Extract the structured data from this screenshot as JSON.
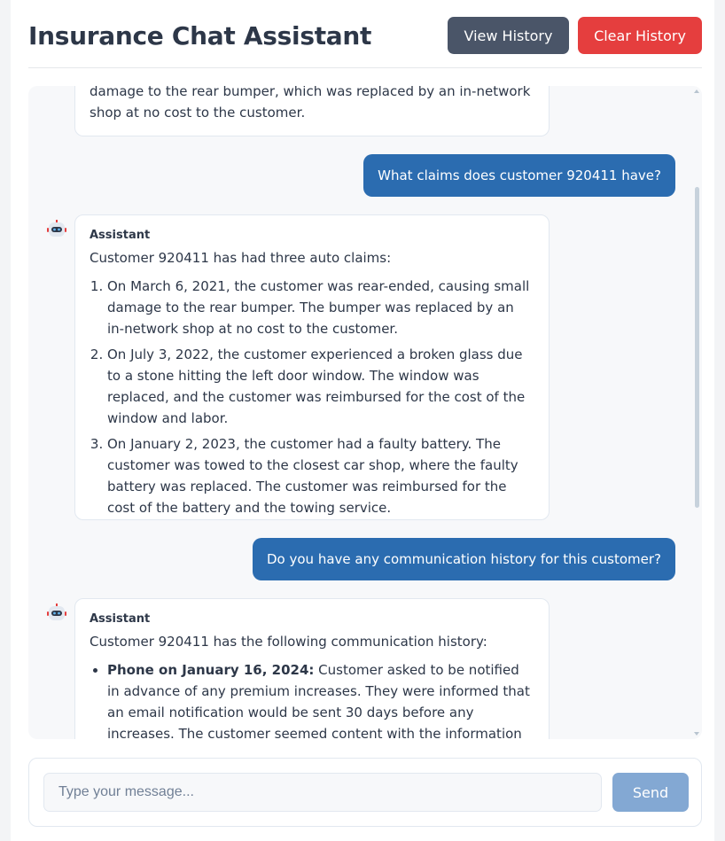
{
  "header": {
    "title": "Insurance Chat Assistant",
    "view_history_label": "View History",
    "clear_history_label": "Clear History"
  },
  "colors": {
    "primary": "#2b6cb0",
    "danger": "#e53e3e",
    "secondary": "#4a5568",
    "send_disabled": "#83a8d3"
  },
  "chat": {
    "partial_top": "damage to the rear bumper, which was replaced by an in-network shop at no cost to the customer.",
    "messages": [
      {
        "role": "user",
        "text": "What claims does customer 920411 have?"
      },
      {
        "role": "assistant",
        "name": "Assistant",
        "intro": "Customer 920411 has had three auto claims:",
        "items": [
          "On March 6, 2021, the customer was rear-ended, causing small damage to the rear bumper. The bumper was replaced by an in-network shop at no cost to the customer.",
          "On July 3, 2022, the customer experienced a broken glass due to a stone hitting the left door window. The window was replaced, and the customer was reimbursed for the cost of the window and labor.",
          "On January 2, 2023, the customer had a faulty battery. The customer was towed to the closest car shop, where the faulty battery was replaced. The customer was reimbursed for the cost of the battery and the towing service."
        ]
      },
      {
        "role": "user",
        "text": "Do you have any communication history for this customer?"
      },
      {
        "role": "assistant",
        "name": "Assistant",
        "intro": "Customer 920411 has the following communication history:",
        "items": [
          {
            "label": "Phone on January 16, 2024:",
            "text": " Customer asked to be notified in advance of any premium increases. They were informed that an email notification would be sent 30 days before any increases. The customer seemed content with the information but unhappy that no"
          }
        ]
      }
    ],
    "avatar_icon": "robot-icon"
  },
  "composer": {
    "placeholder": "Type your message...",
    "send_label": "Send"
  }
}
